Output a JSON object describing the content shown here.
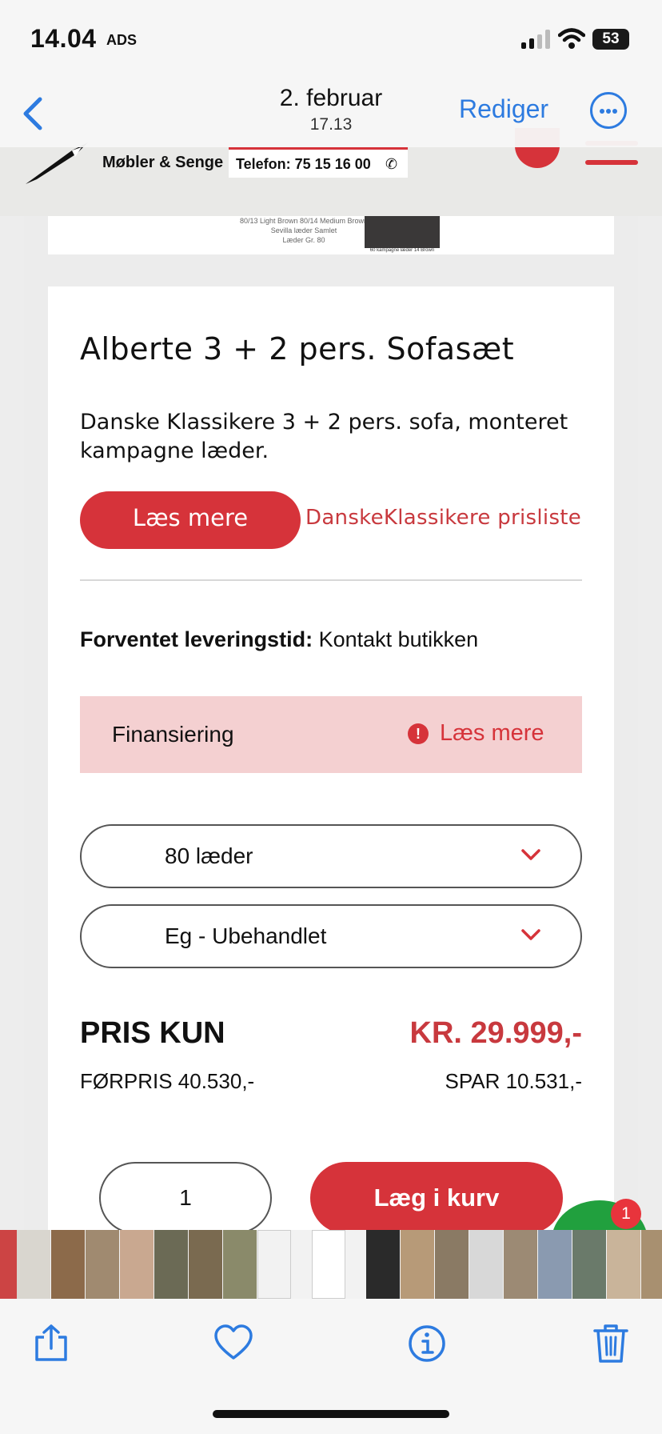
{
  "status_bar": {
    "time": "14.04",
    "time_suffix": "ADS",
    "battery": "53"
  },
  "photo_nav": {
    "date": "2. februar",
    "time": "17.13",
    "edit_label": "Rediger"
  },
  "site_header": {
    "logo_text": "Møbler & Senge",
    "phone": "Telefon: 75 15 16 00"
  },
  "swatches": {
    "line1": "80/13 Light Brown    80/14 Medium Brown",
    "line2": "Sevilla læder Samlet",
    "line3": "Læder Gr. 80",
    "caption": "60 kampagne læder 14 Brown"
  },
  "product": {
    "title": "Alberte 3 + 2 pers. Sofasæt",
    "description": "Danske Klassikere 3 + 2 pers. sofa, monteret kampagne læder.",
    "read_more": "Læs mere",
    "price_list_link": "DanskeKlassikere prisliste",
    "delivery_label": "Forventet leveringstid:",
    "delivery_value": " Kontakt butikken"
  },
  "financing": {
    "label": "Finansiering",
    "icon_glyph": "!",
    "link": "Læs mere"
  },
  "options": {
    "leather": "80 læder",
    "wood": "Eg - Ubehandlet"
  },
  "pricing": {
    "label": "PRIS KUN",
    "price": "KR. 29.999,-",
    "before": "FØRPRIS 40.530,-",
    "saving": "SPAR 10.531,-"
  },
  "cart": {
    "quantity": "1",
    "add_label": "Læg i kurv"
  },
  "chat": {
    "badge": "1"
  },
  "colors": {
    "accent": "#d6333a",
    "ios_blue": "#2d7be0",
    "finance_bg": "#f4d0d1"
  },
  "icons": [
    "back-chevron-icon",
    "more-icon",
    "search-icon",
    "menu-icon",
    "phone-icon",
    "alert-icon",
    "chevron-down-icon",
    "share-icon",
    "heart-icon",
    "info-icon",
    "trash-icon"
  ]
}
